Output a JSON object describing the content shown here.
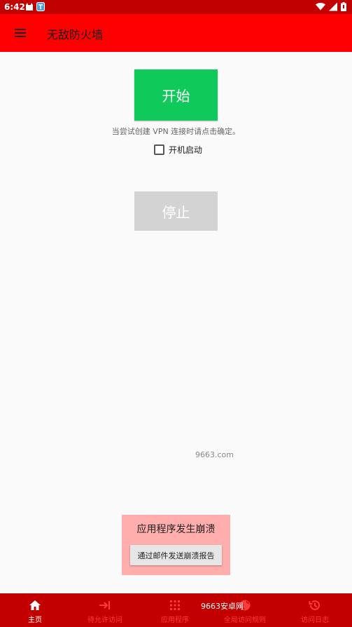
{
  "status_bar": {
    "time": "6:42"
  },
  "app_bar": {
    "title": "无敌防火墙"
  },
  "main": {
    "start_label": "开始",
    "hint": "当尝试创建 VPN 连接时请点击确定。",
    "boot_label": "开机启动",
    "stop_label": "停止",
    "watermark": "9663.com"
  },
  "crash": {
    "title": "应用程序发生崩溃",
    "button": "通过邮件发送崩溃报告"
  },
  "bottom_nav": {
    "items": [
      {
        "label": "主页",
        "icon": "home-icon"
      },
      {
        "label": "待允许访问",
        "icon": "arrow-right-bar-icon"
      },
      {
        "label": "应用程序",
        "icon": "apps-grid-icon"
      },
      {
        "label": "全局访问规则",
        "icon": "globe-icon"
      },
      {
        "label": "访问日志",
        "icon": "history-icon"
      }
    ],
    "watermark": "9663安卓网"
  },
  "colors": {
    "status_bar": "#c10000",
    "app_bar": "#ff0000",
    "start": "#0fc95a",
    "stop": "#d3d3d3",
    "crash_box": "#ffadad",
    "bottom_nav": "#c20000"
  }
}
